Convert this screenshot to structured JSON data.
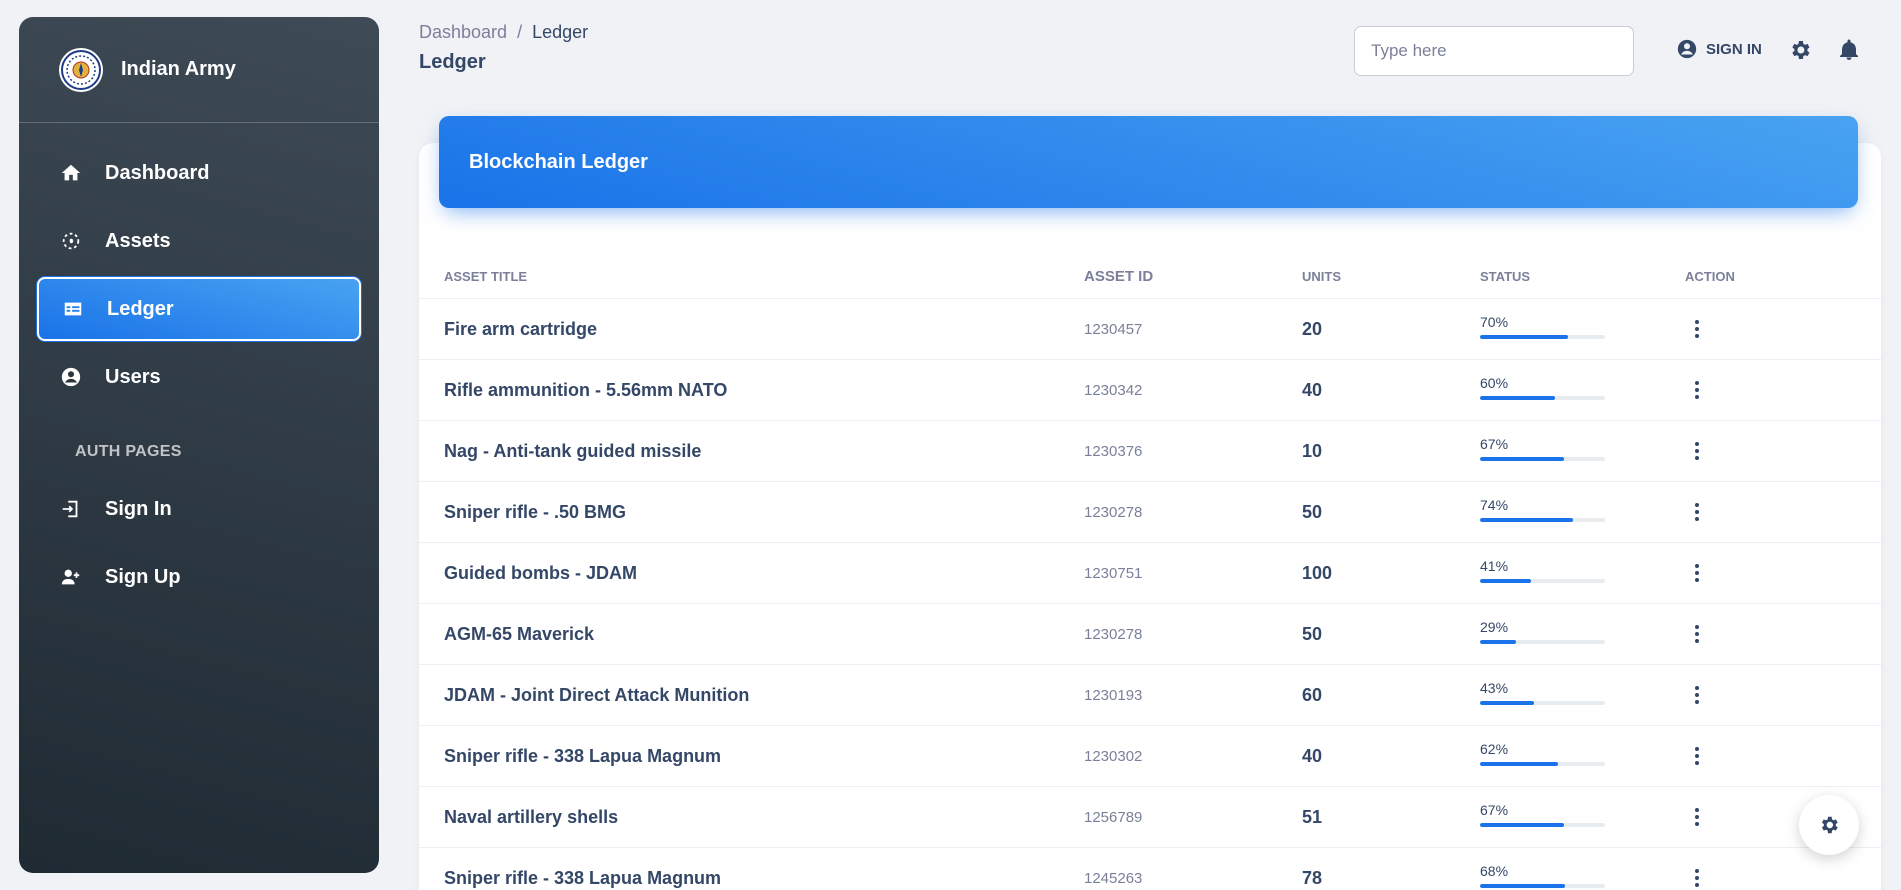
{
  "brand": {
    "name": "Indian Army"
  },
  "sidebar": {
    "items": [
      {
        "label": "Dashboard",
        "icon": "home-icon"
      },
      {
        "label": "Assets",
        "icon": "assets-icon"
      },
      {
        "label": "Ledger",
        "icon": "table-icon",
        "active": true
      },
      {
        "label": "Users",
        "icon": "user-circle-icon"
      }
    ],
    "section_label": "AUTH PAGES",
    "auth_items": [
      {
        "label": "Sign In",
        "icon": "login-icon"
      },
      {
        "label": "Sign Up",
        "icon": "person-add-icon"
      }
    ]
  },
  "header": {
    "breadcrumb": {
      "root": "Dashboard",
      "separator": "/",
      "current": "Ledger"
    },
    "title": "Ledger",
    "search_placeholder": "Type here",
    "signin_label": "SIGN IN"
  },
  "card": {
    "title": "Blockchain Ledger"
  },
  "table": {
    "columns": [
      "ASSET TITLE",
      "ASSET ID",
      "UNITS",
      "STATUS",
      "ACTION"
    ],
    "rows": [
      {
        "title": "Fire arm cartridge",
        "id": "1230457",
        "units": "20",
        "status": "70%",
        "progress": 70
      },
      {
        "title": "Rifle ammunition - 5.56mm NATO",
        "id": "1230342",
        "units": "40",
        "status": "60%",
        "progress": 60
      },
      {
        "title": "Nag - Anti-tank guided missile",
        "id": "1230376",
        "units": "10",
        "status": "67%",
        "progress": 67
      },
      {
        "title": "Sniper rifle - .50 BMG",
        "id": "1230278",
        "units": "50",
        "status": "74%",
        "progress": 74
      },
      {
        "title": "Guided bombs - JDAM",
        "id": "1230751",
        "units": "100",
        "status": "41%",
        "progress": 41
      },
      {
        "title": "AGM-65 Maverick",
        "id": "1230278",
        "units": "50",
        "status": "29%",
        "progress": 29
      },
      {
        "title": "JDAM - Joint Direct Attack Munition",
        "id": "1230193",
        "units": "60",
        "status": "43%",
        "progress": 43
      },
      {
        "title": "Sniper rifle - 338 Lapua Magnum",
        "id": "1230302",
        "units": "40",
        "status": "62%",
        "progress": 62
      },
      {
        "title": "Naval artillery shells",
        "id": "1256789",
        "units": "51",
        "status": "67%",
        "progress": 67
      },
      {
        "title": "Sniper rifle - 338 Lapua Magnum",
        "id": "1245263",
        "units": "78",
        "status": "68%",
        "progress": 68
      }
    ]
  },
  "colors": {
    "accent": "#1a73e8",
    "sidebar_bg": "#2b363f",
    "text": "#344767",
    "muted": "#7b809a"
  }
}
